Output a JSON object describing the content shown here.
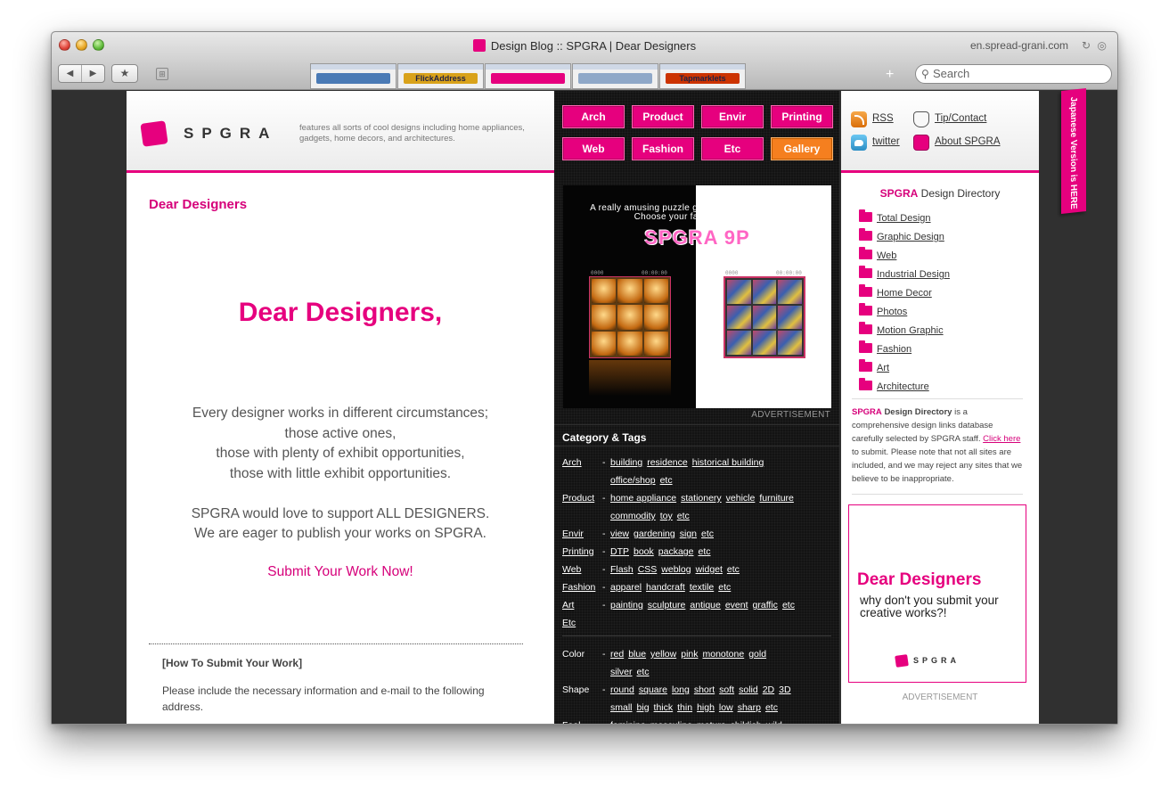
{
  "window": {
    "title": "Design Blog :: SPGRA | Dear Designers",
    "url": "en.spread-grani.com"
  },
  "toolbar": {
    "back_glyph": "◀",
    "forward_glyph": "▶",
    "bookmark_glyph": "★",
    "topsites_glyph": "⊞",
    "new_tab_glyph": "+",
    "search_placeholder": "Search",
    "thumbnails": [
      {
        "label": "",
        "color": "#4a7ab5"
      },
      {
        "label": "FlickAddress",
        "color": "#d9a21a"
      },
      {
        "label": "",
        "color": "#e6007e"
      },
      {
        "label": "",
        "color": "#8fa8c8"
      },
      {
        "label": "Tapmarklets",
        "color": "#cc3300"
      }
    ]
  },
  "header": {
    "logo_text": "SPGRA",
    "tagline": "features all sorts of cool designs including home appliances, gadgets, home decors, and architectures."
  },
  "categories": [
    {
      "label": "Arch"
    },
    {
      "label": "Product"
    },
    {
      "label": "Envir"
    },
    {
      "label": "Printing"
    },
    {
      "label": "Web"
    },
    {
      "label": "Fashion"
    },
    {
      "label": "Etc"
    },
    {
      "label": "Gallery"
    }
  ],
  "main": {
    "page_heading": "Dear Designers",
    "big_heading": "Dear Designers,",
    "body_lines": [
      "Every designer works in different circumstances;",
      "those active ones,",
      "those with plenty of exhibit opportunities,",
      "those with little exhibit opportunities.",
      "",
      "SPGRA would love to support ALL DESIGNERS.",
      "We are eager to publish your works on SPGRA."
    ],
    "submit_link": "Submit Your Work Now!",
    "how_heading": "[How To Submit Your Work]",
    "how_text": "Please include the necessary information and e-mail to the following address."
  },
  "ad_widget": {
    "line1": "A really amusing puzzle game widget for your blog.",
    "line2": "Choose your favorite pictures!",
    "title": "SPGRA 9P",
    "timer_left": "0000",
    "clock_left": "00:00:00",
    "timer_right": "0000",
    "clock_right": "00:00:00",
    "caption": "ADVERTISEMENT"
  },
  "tags": {
    "heading": "Category & Tags",
    "rows": [
      {
        "label": "Arch",
        "tags": [
          "building",
          "residence",
          "historical building"
        ]
      },
      {
        "label": "",
        "tags": [
          "office/shop",
          "etc"
        ]
      },
      {
        "label": "Product",
        "tags": [
          "home appliance",
          "stationery",
          "vehicle",
          "furniture"
        ]
      },
      {
        "label": "",
        "tags": [
          "commodity",
          "toy",
          "etc"
        ]
      },
      {
        "label": "Envir",
        "tags": [
          "view",
          "gardening",
          "sign",
          "etc"
        ]
      },
      {
        "label": "Printing",
        "tags": [
          "DTP",
          "book",
          "package",
          "etc"
        ]
      },
      {
        "label": "Web",
        "tags": [
          "Flash",
          "CSS",
          "weblog",
          "widget",
          "etc"
        ]
      },
      {
        "label": "Fashion",
        "tags": [
          "apparel",
          "handcraft",
          "textile",
          "etc"
        ]
      },
      {
        "label": "Art",
        "tags": [
          "painting",
          "sculpture",
          "antique",
          "event",
          "graffic",
          "etc"
        ]
      },
      {
        "label": "Etc",
        "tags": []
      }
    ],
    "rows2": [
      {
        "label": "Color",
        "tags": [
          "red",
          "blue",
          "yellow",
          "pink",
          "monotone",
          "gold"
        ]
      },
      {
        "label": "",
        "tags": [
          "silver",
          "etc"
        ]
      },
      {
        "label": "Shape",
        "tags": [
          "round",
          "square",
          "long",
          "short",
          "soft",
          "solid",
          "2D",
          "3D"
        ]
      },
      {
        "label": "",
        "tags": [
          "small",
          "big",
          "thick",
          "thin",
          "high",
          "low",
          "sharp",
          "etc"
        ]
      },
      {
        "label": "Feel",
        "tags": [
          "feminine",
          "masculine",
          "mature",
          "childish",
          "wild"
        ]
      }
    ]
  },
  "right": {
    "rss": "RSS",
    "tip": "Tip/Contact",
    "twitter": "twitter",
    "about": "About SPGRA",
    "dir_heading_brand": "SPGRA",
    "dir_heading_rest": "Design Directory",
    "dir_items": [
      "Total Design",
      "Graphic Design",
      "Web",
      "Industrial Design",
      "Home Decor",
      "Photos",
      "Motion Graphic",
      "Fashion",
      "Art",
      "Architecture"
    ],
    "desc_brand": "SPGRA",
    "desc_bold": "Design Directory",
    "desc_text1": "is a comprehensive design links database carefully selected by SPGRA staff.",
    "desc_click": "Click here",
    "desc_text2": "to submit. Please note that not all sites are included, and we may reject any sites that we believe to be inappropriate.",
    "ad_heading": "Dear Designers",
    "ad_text": "why don't you submit your creative works?!",
    "ad_logo": "SPGRA",
    "ad_caption": "ADVERTISEMENT"
  },
  "jp_tab": "Japanese Version is HERE"
}
